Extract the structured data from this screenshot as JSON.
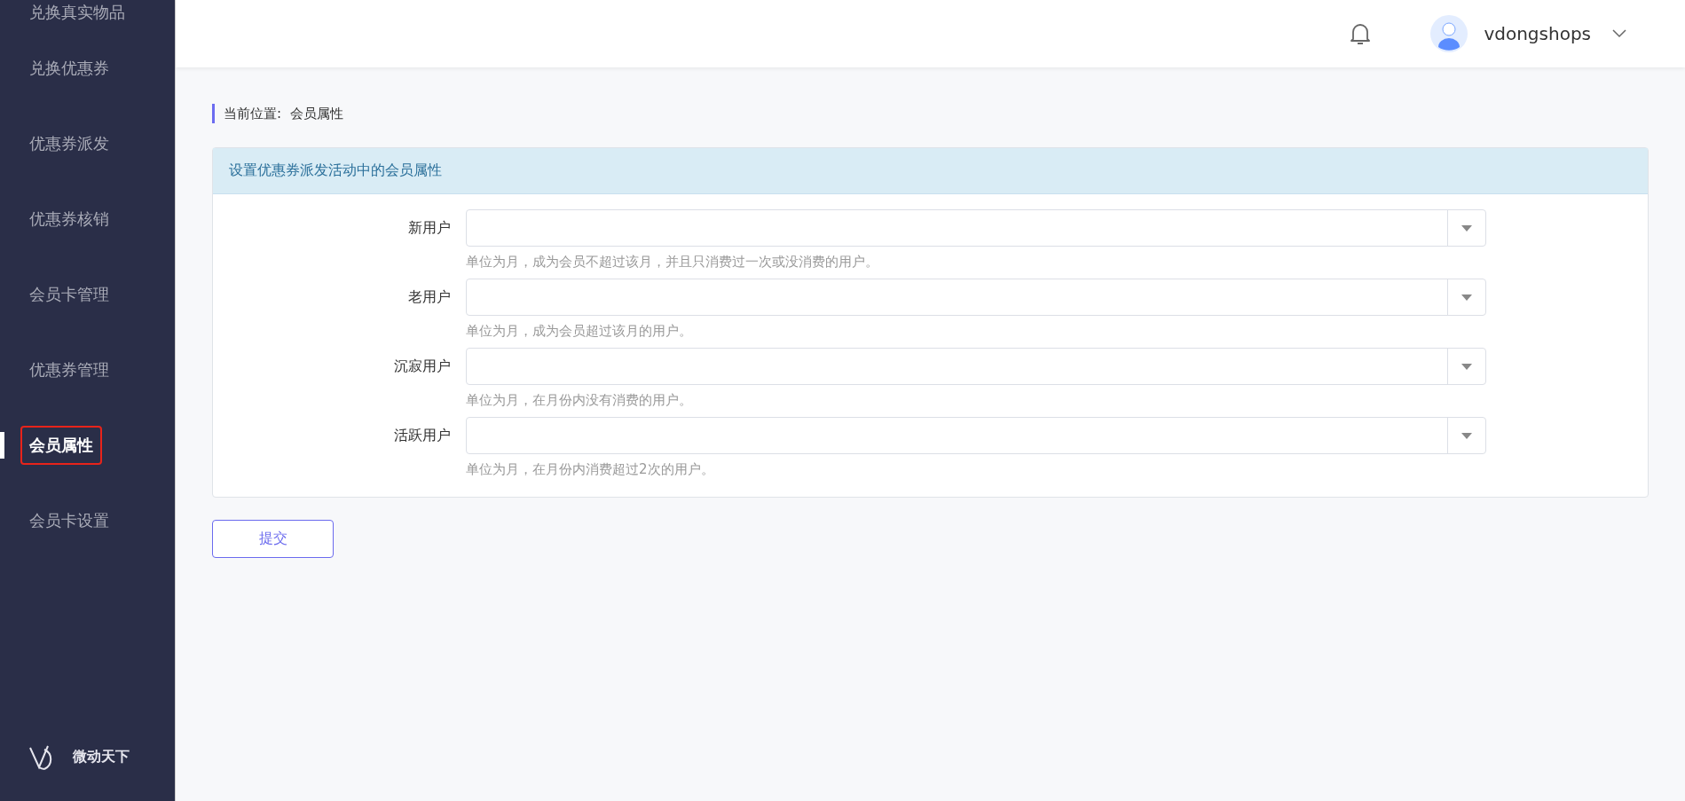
{
  "sidebar": {
    "items": [
      {
        "label": "兑换真实物品",
        "selected": false
      },
      {
        "label": "兑换优惠券",
        "selected": false
      },
      {
        "label": "优惠券派发",
        "selected": false
      },
      {
        "label": "优惠券核销",
        "selected": false
      },
      {
        "label": "会员卡管理",
        "selected": false
      },
      {
        "label": "优惠券管理",
        "selected": false
      },
      {
        "label": "会员属性",
        "selected": true
      },
      {
        "label": "会员卡设置",
        "selected": false
      }
    ],
    "brand": "微动天下"
  },
  "header": {
    "username": "vdongshops"
  },
  "breadcrumb": {
    "label": "当前位置:",
    "current": "会员属性"
  },
  "panel": {
    "title": "设置优惠券派发活动中的会员属性",
    "fields": [
      {
        "label": "新用户",
        "hint": "单位为月，成为会员不超过该月，并且只消费过一次或没消费的用户。"
      },
      {
        "label": "老用户",
        "hint": "单位为月，成为会员超过该月的用户。"
      },
      {
        "label": "沉寂用户",
        "hint": "单位为月，在月份内没有消费的用户。"
      },
      {
        "label": "活跃用户",
        "hint": "单位为月，在月份内消费超过2次的用户。"
      }
    ]
  },
  "submit": "提交"
}
